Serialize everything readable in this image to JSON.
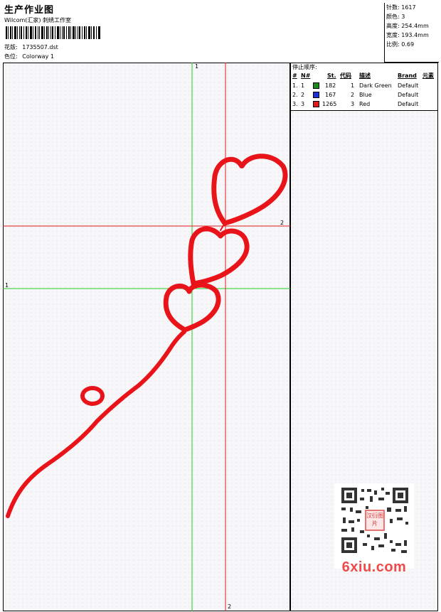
{
  "header": {
    "title": "生产作业图",
    "company": "Wilcom(汇家) 刺绣工作室",
    "design_label": "花版:",
    "design_value": "1735507.dst",
    "colorway_label": "色位:",
    "colorway_value": "Colorway 1"
  },
  "stats": [
    {
      "label": "针数:",
      "value": "1617"
    },
    {
      "label": "颜色:",
      "value": "3"
    },
    {
      "label": "高度:",
      "value": "254.4mm"
    },
    {
      "label": "宽度:",
      "value": "193.4mm"
    },
    {
      "label": "比例:",
      "value": "0.69"
    }
  ],
  "stop_sequence": {
    "title": "停止顺序:",
    "headers": {
      "hash": "#",
      "num": "N#",
      "st": "St.",
      "code": "代码",
      "desc": "描述",
      "brand": "Brand",
      "elem": "元素"
    },
    "rows": [
      {
        "idx": "1.",
        "n": "1",
        "color": "#1a8a1a",
        "st": "182",
        "code": "1",
        "desc": "Dark Green",
        "brand": "Default"
      },
      {
        "idx": "2.",
        "n": "2",
        "color": "#1a2fd8",
        "st": "167",
        "code": "2",
        "desc": "Blue",
        "brand": "Default"
      },
      {
        "idx": "3.",
        "n": "3",
        "color": "#e01a1a",
        "st": "1265",
        "code": "3",
        "desc": "Red",
        "brand": "Default"
      }
    ]
  },
  "guides": {
    "green_label_top": "1",
    "green_label_left": "1",
    "red_label_right": "2",
    "red_label_bottom": "2"
  },
  "watermark": {
    "text": "6xiu.com",
    "badge": "汉衍图片"
  }
}
